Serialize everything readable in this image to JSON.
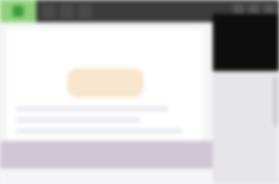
{
  "window": {
    "tabs": [
      {
        "label": ""
      },
      {
        "label": ""
      },
      {
        "label": ""
      }
    ]
  },
  "main": {
    "heading": "",
    "footer_text": "",
    "link_text": ""
  },
  "colors": {
    "accent": "#f7e6cc",
    "app_icon": "#8fd07a",
    "panel_dark": "#0d0d0d",
    "footer_band": "#cfc7d4"
  },
  "icons": {
    "app": "app-icon",
    "controls": [
      "minimize-icon",
      "maximize-icon",
      "close-icon"
    ]
  }
}
